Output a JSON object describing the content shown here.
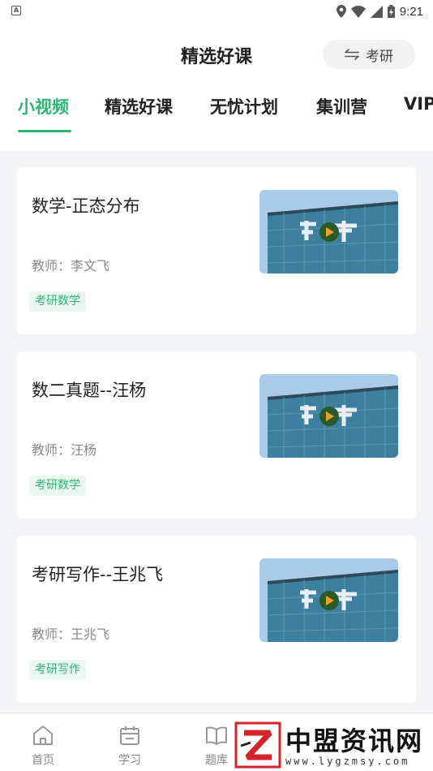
{
  "status_bar": {
    "time": "9:21",
    "app_icon_letter": "A"
  },
  "header": {
    "title": "精选好课",
    "exam_switch_label": "考研"
  },
  "tabs": [
    {
      "label": "小视频",
      "active": true
    },
    {
      "label": "精选好课",
      "active": false
    },
    {
      "label": "无忧计划",
      "active": false
    },
    {
      "label": "集训营",
      "active": false
    },
    {
      "label": "VIP",
      "active": false
    }
  ],
  "courses": [
    {
      "title": "数学-正态分布",
      "teacher": "教师：李文飞",
      "tag": "考研数学"
    },
    {
      "title": "数二真题--汪杨",
      "teacher": "教师：汪杨",
      "tag": "考研数学"
    },
    {
      "title": "考研写作--王兆飞",
      "teacher": "教师：王兆飞",
      "tag": "考研写作"
    }
  ],
  "bottom_nav": [
    {
      "label": "首页",
      "icon": "home-icon"
    },
    {
      "label": "学习",
      "icon": "calendar-icon"
    },
    {
      "label": "题库",
      "icon": "book-icon"
    }
  ],
  "watermark": {
    "main": "中盟资讯网",
    "sub": "www.lygzmsy.com"
  },
  "colors": {
    "accent": "#2fb573",
    "tag_bg": "#eaf8f0"
  }
}
